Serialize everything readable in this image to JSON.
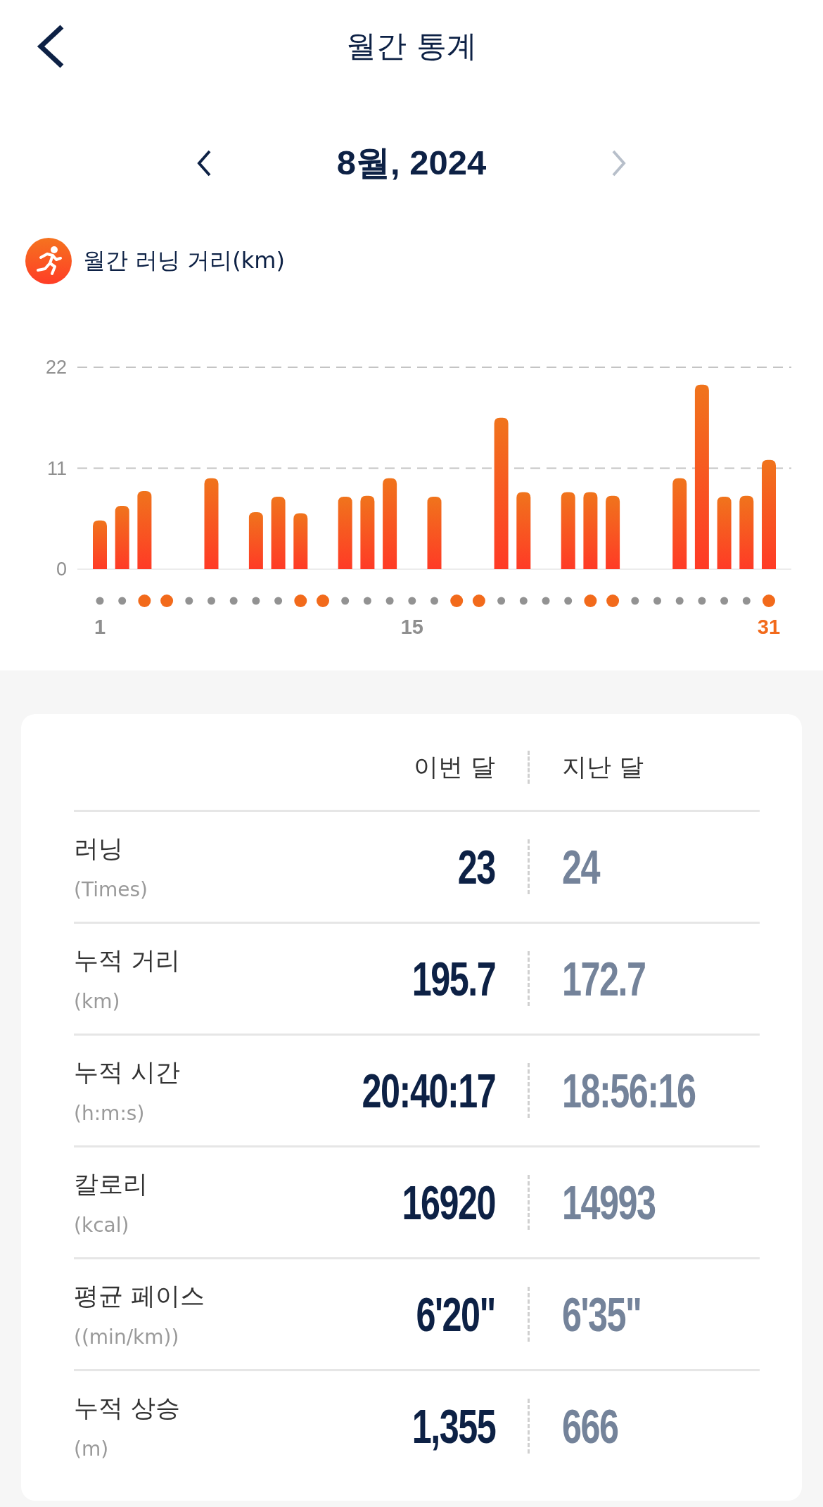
{
  "header": {
    "title": "월간 통계"
  },
  "month_nav": {
    "label": "8월, 2024",
    "prev_disabled": false,
    "next_disabled": true
  },
  "chart_section": {
    "title": "월간 러닝 거리(km)",
    "chart_data": {
      "type": "bar",
      "x": [
        1,
        2,
        3,
        4,
        5,
        6,
        7,
        8,
        9,
        10,
        11,
        12,
        13,
        14,
        15,
        16,
        17,
        18,
        19,
        20,
        21,
        22,
        23,
        24,
        25,
        26,
        27,
        28,
        29,
        30,
        31
      ],
      "xticks": [
        1,
        15,
        31
      ],
      "xlim": [
        1,
        31
      ],
      "values": [
        5.3,
        6.9,
        8.5,
        null,
        null,
        9.9,
        null,
        6.2,
        7.9,
        6.1,
        null,
        7.9,
        8.0,
        9.9,
        null,
        7.9,
        null,
        null,
        16.5,
        8.4,
        null,
        8.4,
        8.4,
        8.0,
        null,
        null,
        9.9,
        20.1,
        7.9,
        8.0,
        11.9
      ],
      "ylim": [
        0,
        22
      ],
      "yticks": [
        0,
        11,
        22
      ]
    },
    "day_marks": [
      {
        "weekend": false
      },
      {
        "weekend": false
      },
      {
        "weekend": true
      },
      {
        "weekend": true
      },
      {
        "weekend": false
      },
      {
        "weekend": false
      },
      {
        "weekend": false
      },
      {
        "weekend": false
      },
      {
        "weekend": false
      },
      {
        "weekend": true
      },
      {
        "weekend": true
      },
      {
        "weekend": false
      },
      {
        "weekend": false
      },
      {
        "weekend": false
      },
      {
        "weekend": false
      },
      {
        "weekend": false
      },
      {
        "weekend": true
      },
      {
        "weekend": true
      },
      {
        "weekend": false
      },
      {
        "weekend": false
      },
      {
        "weekend": false
      },
      {
        "weekend": false
      },
      {
        "weekend": true
      },
      {
        "weekend": true
      },
      {
        "weekend": false
      },
      {
        "weekend": false
      },
      {
        "weekend": false
      },
      {
        "weekend": false
      },
      {
        "weekend": false
      },
      {
        "weekend": false
      },
      {
        "weekend": true
      }
    ],
    "xtick_states": [
      {
        "selected": false
      },
      {
        "selected": false
      },
      {
        "selected": true
      }
    ]
  },
  "comparison": {
    "columns": [
      "이번 달",
      "지난 달"
    ],
    "rows": [
      {
        "label": "러닝",
        "unit": "(Times)",
        "this_month": "23",
        "last_month": "24"
      },
      {
        "label": "누적 거리",
        "unit": "(km)",
        "this_month": "195.7",
        "last_month": "172.7"
      },
      {
        "label": "누적 시간",
        "unit": "(h:m:s)",
        "this_month": "20:40:17",
        "last_month": "18:56:16"
      },
      {
        "label": "칼로리",
        "unit": "(kcal)",
        "this_month": "16920",
        "last_month": "14993"
      },
      {
        "label": "평균 페이스",
        "unit": "((min/km))",
        "this_month": "6'20\"",
        "last_month": "6'35\""
      },
      {
        "label": "누적 상승",
        "unit": "(m)",
        "this_month": "1,355",
        "last_month": "666"
      }
    ]
  }
}
